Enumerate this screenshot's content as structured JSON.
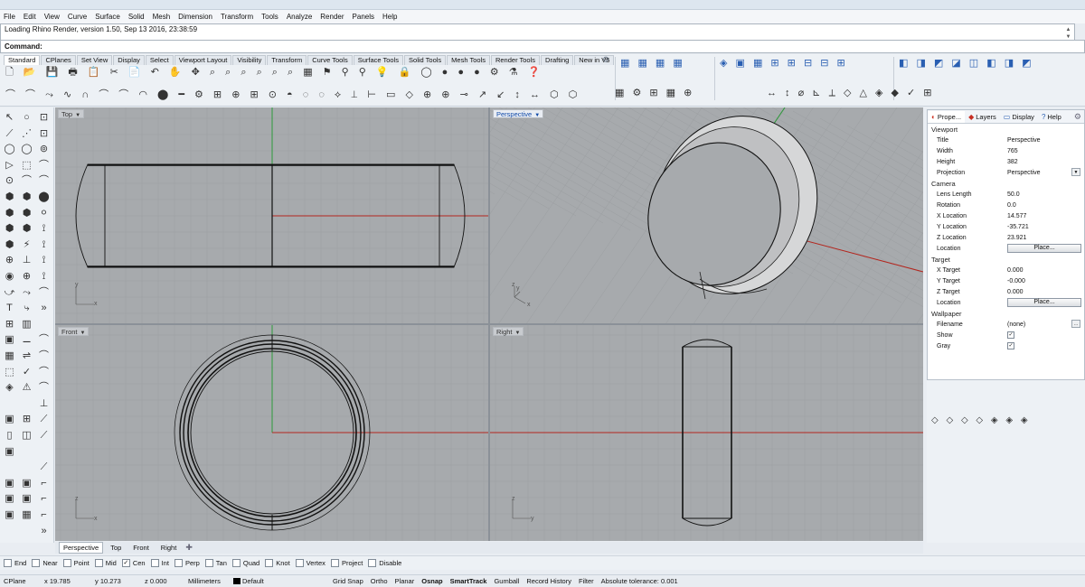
{
  "menu": [
    "File",
    "Edit",
    "View",
    "Curve",
    "Surface",
    "Solid",
    "Mesh",
    "Dimension",
    "Transform",
    "Tools",
    "Analyze",
    "Render",
    "Panels",
    "Help"
  ],
  "command_history": "Loading Rhino Render, version 1.50, Sep 13 2016, 23:38:59",
  "command_prompt": "Command:",
  "toolbar_tabs": [
    "Standard",
    "CPlanes",
    "Set View",
    "Display",
    "Select",
    "Viewport Layout",
    "Visibility",
    "Transform",
    "Curve Tools",
    "Surface Tools",
    "Solid Tools",
    "Mesh Tools",
    "Render Tools",
    "Drafting",
    "New in V5"
  ],
  "toolbar_rows": {
    "row1": "🗋 📂 💾 🖶 📋 ✂ 📄 ↶ ✋ ✥ ⌕ ⌕ ⌕ ⌕ ⌕ ⌕ ▦ ⚑ ⚲ ⚲ 💡 🔒 ◯ ● ● ● ⚙ ⚗ ❓",
    "row2": "⌒ ⌒ ⤳ ∿ ∩ ⌒ ⌒ ◠ ⬤ ━ ⚙ ⊞ ⊕ ⊞ ⊙ ◓ ◌ ◌ ⟡ ⟂ ⊢ ▭ ◇ ⊕ ⊕ ⊸ ↗ ↙ ↕ ↔ ⬡ ⬡",
    "right_groups": {
      "group1": "▦ ▦ ▦ ▦",
      "group2": "◈ ▣ ▦ ⊞ ⊞ ⊟ ⊟ ⊞",
      "group3": "◧ ◨ ◩ ◪ ◫ ◧ ◨ ◩",
      "row2_group1": "▦ ⚙ ⊞ ▦ ⊕",
      "row2_group2": "↔ ↕ ⌀ ⊾ ⟂ ◇ △ ◈ ◆ ✓ ⊞"
    }
  },
  "left_toolbar_rows": [
    [
      "↖",
      "○",
      "⊡"
    ],
    [
      "⟋",
      "⋰",
      "⊡"
    ],
    [
      "◯",
      "◯",
      "⊚"
    ],
    [
      "▷",
      "⬚",
      "⌒"
    ],
    [
      "⊙",
      "⌒",
      "⌒"
    ],
    [
      "⬢",
      "⬢",
      "⬤"
    ],
    [
      "⬢",
      "⬢",
      "⚪"
    ],
    [
      "⬢",
      "⬢",
      "⟟"
    ],
    [
      "⬢",
      "⚡",
      "⟟"
    ],
    [
      "⊕",
      "⊥",
      "⟟"
    ],
    [
      "◉",
      "⊕",
      "⟟"
    ],
    [
      "⤻",
      "⤳",
      "⌒"
    ],
    [
      "T",
      "⤷",
      "»"
    ],
    [
      "⊞",
      "▥",
      ""
    ],
    [
      "▣",
      "⚊",
      "⌒"
    ],
    [
      "▦",
      "⇌",
      "⌒"
    ],
    [
      "⬚",
      "✓",
      "⌒"
    ],
    [
      "◈",
      "⚠",
      "⌒"
    ],
    [
      "",
      "",
      "⊥"
    ],
    [
      "▣",
      "⊞",
      "⟋"
    ],
    [
      "▯",
      "◫",
      "⟋"
    ],
    [
      "▣",
      "",
      ""
    ],
    [
      "",
      "",
      "⟋"
    ],
    [
      "▣",
      "▣",
      "⌐"
    ],
    [
      "▣",
      "▣",
      "⌐"
    ],
    [
      "▣",
      "▦",
      "⌐"
    ],
    [
      "",
      "",
      "»"
    ]
  ],
  "viewports": {
    "top": {
      "title": "Top"
    },
    "perspective": {
      "title": "Perspective"
    },
    "front": {
      "title": "Front"
    },
    "right": {
      "title": "Right"
    }
  },
  "viewport_tabs": [
    "Perspective",
    "Top",
    "Front",
    "Right"
  ],
  "osnaps": [
    {
      "label": "End",
      "checked": false
    },
    {
      "label": "Near",
      "checked": false
    },
    {
      "label": "Point",
      "checked": false
    },
    {
      "label": "Mid",
      "checked": false
    },
    {
      "label": "Cen",
      "checked": true
    },
    {
      "label": "Int",
      "checked": false
    },
    {
      "label": "Perp",
      "checked": false
    },
    {
      "label": "Tan",
      "checked": false
    },
    {
      "label": "Quad",
      "checked": false
    },
    {
      "label": "Knot",
      "checked": false
    },
    {
      "label": "Vertex",
      "checked": false
    },
    {
      "label": "Project",
      "checked": false
    },
    {
      "label": "Disable",
      "checked": false
    }
  ],
  "status": {
    "cplane": "CPlane",
    "x": "x 19.785",
    "y": "y 10.273",
    "z": "z 0.000",
    "units": "Millimeters",
    "layer": "Default",
    "grid_snap": "Grid Snap",
    "ortho": "Ortho",
    "planar": "Planar",
    "osnap": "Osnap",
    "smarttrack": "SmartTrack",
    "gumball": "Gumball",
    "record_history": "Record History",
    "filter": "Filter",
    "tolerance": "Absolute tolerance: 0.001"
  },
  "panel": {
    "tabs": [
      {
        "label": "Prope...",
        "icon": "◐"
      },
      {
        "label": "Layers",
        "icon": "◆"
      },
      {
        "label": "Display",
        "icon": "▭"
      },
      {
        "label": "Help",
        "icon": "?"
      }
    ],
    "viewport_section": "Viewport",
    "viewport_rows": [
      {
        "label": "Title",
        "value": "Perspective"
      },
      {
        "label": "Width",
        "value": "765"
      },
      {
        "label": "Height",
        "value": "382"
      },
      {
        "label": "Projection",
        "value": "Perspective"
      }
    ],
    "camera_section": "Camera",
    "camera_rows": [
      {
        "label": "Lens Length",
        "value": "50.0"
      },
      {
        "label": "Rotation",
        "value": "0.0"
      },
      {
        "label": "X Location",
        "value": "14.577"
      },
      {
        "label": "Y Location",
        "value": "-35.721"
      },
      {
        "label": "Z Location",
        "value": "23.921"
      }
    ],
    "camera_location_label": "Location",
    "camera_place_button": "Place...",
    "target_section": "Target",
    "target_rows": [
      {
        "label": "X Target",
        "value": "0.000"
      },
      {
        "label": "Y Target",
        "value": "-0.000"
      },
      {
        "label": "Z Target",
        "value": "0.000"
      }
    ],
    "target_location_label": "Location",
    "target_place_button": "Place...",
    "wallpaper_section": "Wallpaper",
    "wallpaper_filename_label": "Filename",
    "wallpaper_filename_value": "(none)",
    "wallpaper_show_label": "Show",
    "wallpaper_gray_label": "Gray",
    "bottom_icons": "◇ ◇ ◇ ◇ ◈ ◈ ◈"
  },
  "axis_labels": {
    "x": "x",
    "y": "y",
    "z": "z"
  },
  "colors": {
    "viewport_bg": "#a7aaad",
    "grid": "#9b9ea1",
    "grid_major": "#8e9194",
    "x_axis": "#b3261e",
    "y_axis": "#2d9a3a",
    "curve": "#111111",
    "active_title": "#114aa8"
  }
}
